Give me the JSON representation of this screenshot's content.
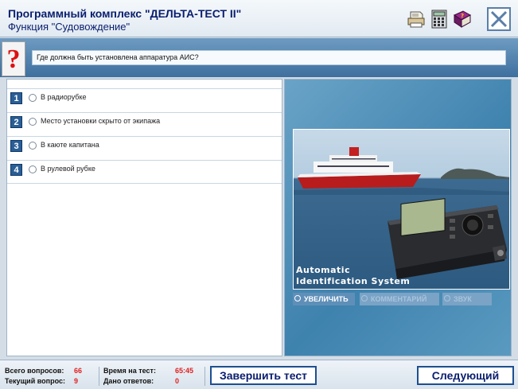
{
  "header": {
    "title": "Программный комплекс \"ДЕЛЬТА-ТЕСТ II\"",
    "subtitle": "Функция \"Судовождение\""
  },
  "question": {
    "text": "Где должна быть установлена аппаратура АИС?"
  },
  "answers": [
    {
      "num": "1",
      "text": "В радиорубке"
    },
    {
      "num": "2",
      "text": "Место установки скрыто от экипажа"
    },
    {
      "num": "3",
      "text": "В каюте капитана"
    },
    {
      "num": "4",
      "text": "В рулевой рубке"
    }
  ],
  "image": {
    "caption_line1": "Automatic",
    "caption_line2": "Identification System",
    "buttons": {
      "zoom": "УВЕЛИЧИТЬ",
      "comments": "КОММЕНТАРИЙ",
      "sound": "ЗВУК"
    }
  },
  "footer": {
    "total_label": "Всего вопросов:",
    "total_value": "66",
    "current_label": "Текущий вопрос:",
    "current_value": "9",
    "time_label": "Время на тест:",
    "time_value": "65:45",
    "answered_label": "Дано ответов:",
    "answered_value": "0",
    "finish_button": "Завершить тест",
    "next_button": "Следующий"
  },
  "colors": {
    "accent": "#1d4f8f",
    "title": "#0a1e6e",
    "counter_red": "#e02020"
  }
}
